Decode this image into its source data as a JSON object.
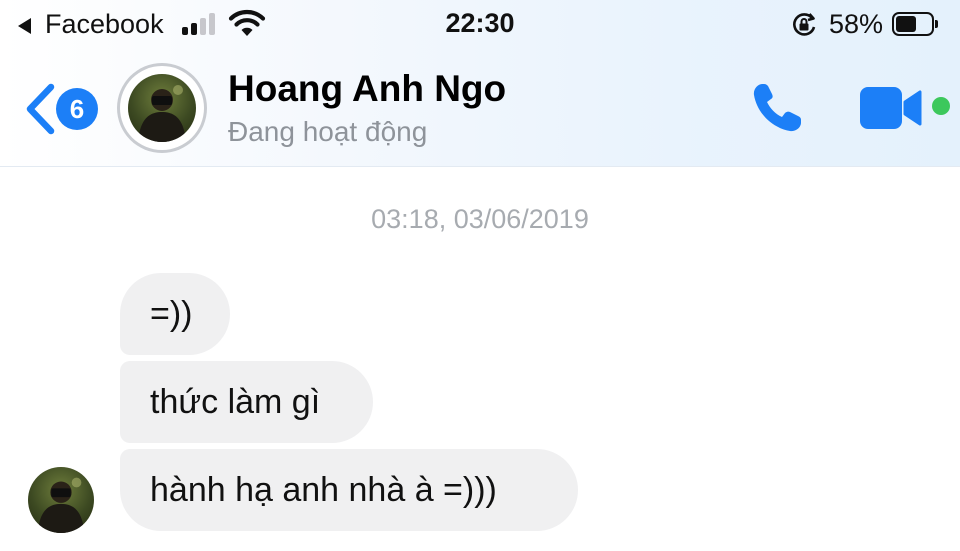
{
  "status_bar": {
    "back_app_label": "Facebook",
    "time": "22:30",
    "battery_percent": "58%",
    "battery_level": 0.58,
    "signal_bars_filled": 2,
    "signal_bars_total": 4
  },
  "header": {
    "unread_count": "6",
    "contact_name": "Hoang Anh Ngo",
    "contact_status": "Đang hoạt động",
    "accent_color": "#1c7ff7",
    "online_color": "#3cc85c"
  },
  "conversation": {
    "timestamp": "03:18, 03/06/2019",
    "messages": [
      {
        "text": "=))"
      },
      {
        "text": "thức làm gì"
      },
      {
        "text": "hành hạ anh nhà à =)))"
      }
    ]
  },
  "icons": {
    "back": "chevron-left-icon",
    "call": "phone-icon",
    "video": "video-camera-icon",
    "wifi": "wifi-icon",
    "rotation_lock": "rotation-lock-icon",
    "battery": "battery-icon"
  }
}
